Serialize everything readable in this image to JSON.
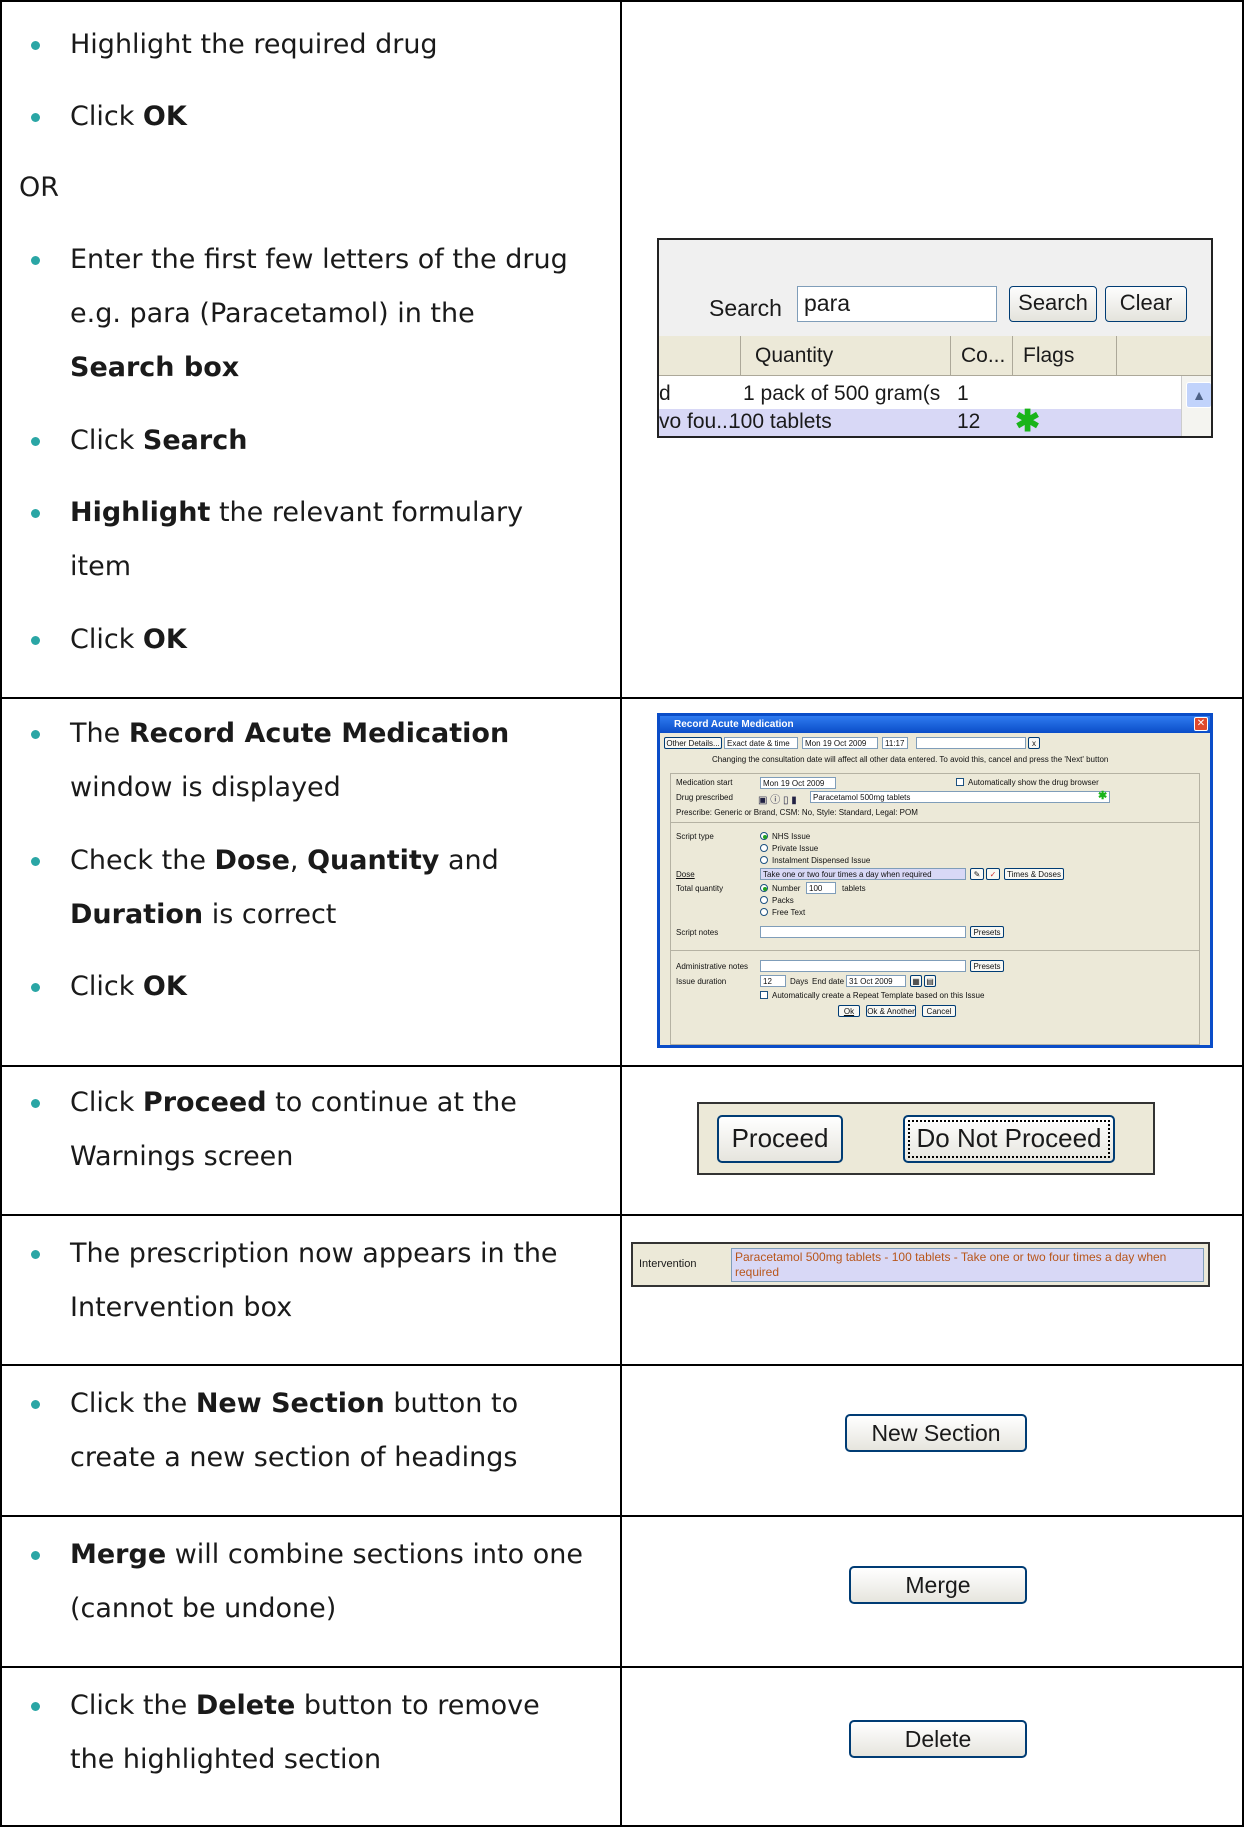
{
  "rows": [
    {
      "lines": [
        {
          "text": "Highlight the required drug"
        },
        {
          "pre": "Click ",
          "bold": "OK"
        }
      ],
      "or": "OR",
      "lines2": [
        {
          "text": "Enter the first few letters of the drug"
        },
        {
          "text": "e.g. para (Paracetamol) in the"
        },
        {
          "bold": "Search box"
        },
        {
          "pre": "Click ",
          "bold": "Search"
        },
        {
          "bold": "Highlight",
          "post": " the relevant formulary"
        },
        {
          "text": "item"
        },
        {
          "pre": "Click ",
          "bold": "OK"
        }
      ]
    },
    {
      "lines": [
        {
          "pre": "The ",
          "bold": "Record Acute Medication"
        },
        {
          "text": "window is displayed"
        },
        {
          "pre": "Check the ",
          "bold": "Dose",
          "mid": ", ",
          "bold2": "Quantity",
          "post": " and"
        },
        {
          "bold": "Duration",
          "post": " is correct"
        },
        {
          "pre": "Click ",
          "bold": "OK"
        }
      ]
    },
    {
      "lines": [
        {
          "pre": "Click ",
          "bold": "Proceed",
          "post": " to continue at the"
        },
        {
          "text": "Warnings screen"
        }
      ]
    },
    {
      "lines": [
        {
          "text": "The prescription now appears in the"
        },
        {
          "text": "Intervention box"
        }
      ]
    },
    {
      "lines": [
        {
          "pre": "Click the ",
          "bold": "New Section",
          "post": " button to"
        },
        {
          "text": "create a new section of headings"
        }
      ]
    },
    {
      "lines": [
        {
          "bold": "Merge",
          "post": " will combine sections into one"
        },
        {
          "text": "(cannot be undone)"
        }
      ]
    },
    {
      "lines": [
        {
          "pre": "Click the ",
          "bold": "Delete",
          "post": " button to remove"
        },
        {
          "text": "the highlighted section"
        }
      ]
    }
  ],
  "search_shot": {
    "label": "Search",
    "value": "para",
    "search_btn": "Search",
    "clear_btn": "Clear",
    "headers": [
      "Quantity",
      "Co...",
      "Flags"
    ],
    "row1": {
      "c0": "d",
      "qty": "1 pack of 500 gram(s",
      "count": "1"
    },
    "row2": {
      "c0": "vo fou...",
      "qty": "100 tablets",
      "count": "12",
      "flag": "✱"
    }
  },
  "dialog": {
    "title": "Record Acute Medication",
    "other_details": "Other Details...",
    "date_mode": "Exact date & time",
    "date": "Mon 19 Oct 2009",
    "time": "11:17",
    "notice": "Changing the consultation date will affect all other data entered. To avoid this, cancel and press the 'Next' button",
    "medication_start_label": "Medication start",
    "medication_start": "Mon 19 Oct 2009",
    "auto_browser": "Automatically show the drug browser",
    "drug_label": "Drug prescribed",
    "drug": "Paracetamol 500mg tablets",
    "prescribe_info": "Prescribe: Generic or Brand, CSM: No, Style: Standard, Legal: POM",
    "script_type_label": "Script type",
    "script_types": [
      "NHS Issue",
      "Private Issue",
      "Instalment Dispensed Issue"
    ],
    "dose_label": "Dose",
    "dose": "Take one or two four times a day when required",
    "times_doses": "Times & Doses",
    "total_qty_label": "Total quantity",
    "qty_options": [
      "Number",
      "Packs",
      "Free Text"
    ],
    "qty_value": "100",
    "qty_unit": "tablets",
    "script_notes_label": "Script notes",
    "presets": "Presets",
    "admin_notes_label": "Administrative notes",
    "issue_duration_label": "Issue duration",
    "issue_duration": "12",
    "days": "Days",
    "end_date_label": "End date",
    "end_date": "31 Oct 2009",
    "repeat_template": "Automatically create a Repeat Template based on this Issue",
    "ok": "Ok",
    "ok_another": "Ok & Another",
    "cancel": "Cancel"
  },
  "proceed_shot": {
    "proceed": "Proceed",
    "not_proceed": "Do Not Proceed"
  },
  "intervention_shot": {
    "label": "Intervention",
    "text": "Paracetamol 500mg tablets - 100 tablets -  Take one or two four times a day when required"
  },
  "buttons": {
    "new_section": "New Section",
    "merge": "Merge",
    "delete": "Delete"
  },
  "colors": {
    "bullet": "#2aa6a5",
    "xp_title": "#0a4dc8",
    "highlight": "#d8d8f6",
    "flag": "#19b419"
  }
}
